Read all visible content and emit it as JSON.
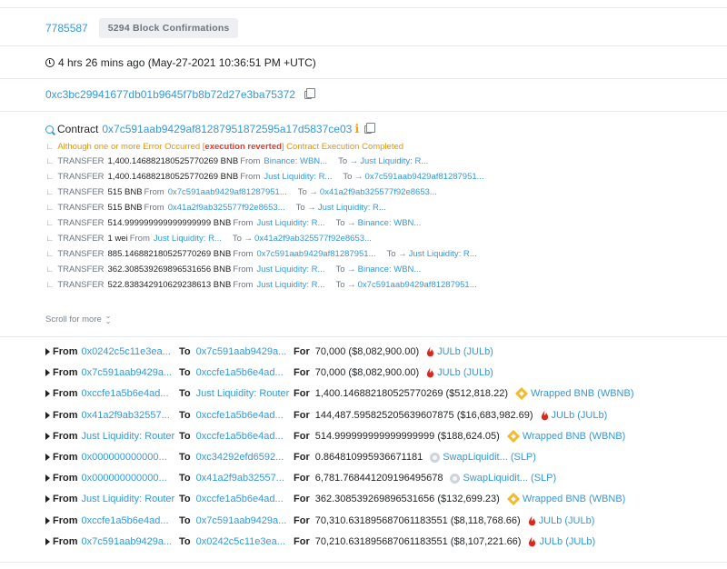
{
  "block": {
    "number": "7785587",
    "confirmations": "5294 Block Confirmations"
  },
  "timestamp": "4 hrs 26 mins ago (May-27-2021 10:36:51 PM +UTC)",
  "from_address": "0xc3bc29941677db01b9645f7b8b72d27e3ba75372",
  "interacted": {
    "label": "Contract",
    "address": "0x7c591aab9429af81287951872595a17d5837ce03",
    "status_pre": "Although one or more Error Occurred [",
    "status_error": "execution reverted",
    "status_post": "] Contract Execution Completed"
  },
  "internal_txs": [
    {
      "label": "TRANSFER",
      "amount": "1,400.146882180525770269 BNB",
      "from": "Binance: WBN...",
      "to": "Just Liquidity: R..."
    },
    {
      "label": "TRANSFER",
      "amount": "1,400.146882180525770269 BNB",
      "from": "Just Liquidity: R...",
      "to": "0x7c591aab9429af81287951..."
    },
    {
      "label": "TRANSFER",
      "amount": "515 BNB",
      "from": "0x7c591aab9429af81287951...",
      "to": "0x41a2f9ab325577f92e8653..."
    },
    {
      "label": "TRANSFER",
      "amount": "515 BNB",
      "from": "0x41a2f9ab325577f92e8653...",
      "to": "Just Liquidity: R..."
    },
    {
      "label": "TRANSFER",
      "amount": "514.999999999999999999 BNB",
      "from": "Just Liquidity: R...",
      "to": "Binance: WBN..."
    },
    {
      "label": "TRANSFER",
      "amount": "1 wei",
      "from": "Just Liquidity: R...",
      "to": "0x41a2f9ab325577f92e8653..."
    },
    {
      "label": "TRANSFER",
      "amount": "885.146882180525770269 BNB",
      "from": "0x7c591aab9429af81287951...",
      "to": "Just Liquidity: R..."
    },
    {
      "label": "TRANSFER",
      "amount": "362.308539269896531656 BNB",
      "from": "Just Liquidity: R...",
      "to": "Binance: WBN..."
    },
    {
      "label": "TRANSFER",
      "amount": "522.838342910629238613 BNB",
      "from": "Just Liquidity: R...",
      "to": "0x7c591aab9429af81287951..."
    }
  ],
  "tx_words": {
    "from": "From",
    "to": "To →",
    "tree": "∟"
  },
  "scroll_more": "Scroll for more",
  "token_words": {
    "from": "From",
    "to": "To",
    "for": "For"
  },
  "token_transfers": [
    {
      "from": "0x0242c5c11e3ea...",
      "to": "0x7c591aab9429a...",
      "amount": "70,000 ($8,082,900.00)",
      "token": "JULb (JULb)",
      "icon": "julb-icon"
    },
    {
      "from": "0x7c591aab9429a...",
      "to": "0xccfe1a5b6e4ad...",
      "amount": "70,000 ($8,082,900.00)",
      "token": "JULb (JULb)",
      "icon": "julb-icon"
    },
    {
      "from": "0xccfe1a5b6e4ad...",
      "to": "Just Liquidity: Router",
      "amount": "1,400.146882180525770269 ($512,818.22)",
      "token": "Wrapped BNB (WBNB)",
      "icon": "bnb-icon"
    },
    {
      "from": "0x41a2f9ab32557...",
      "to": "0xccfe1a5b6e4ad...",
      "amount": "144,487.595825205639607875 ($16,683,982.69)",
      "token": "JULb (JULb)",
      "icon": "julb-icon"
    },
    {
      "from": "Just Liquidity: Router",
      "to": "0xccfe1a5b6e4ad...",
      "amount": "514.999999999999999999 ($188,624.05)",
      "token": "Wrapped BNB (WBNB)",
      "icon": "bnb-icon"
    },
    {
      "from": "0x000000000000...",
      "to": "0xc34292efd6592...",
      "amount": "0.864810995936671181",
      "token": "SwapLiquidit... (SLP)",
      "icon": "slp-icon"
    },
    {
      "from": "0x000000000000...",
      "to": "0x41a2f9ab32557...",
      "amount": "6,781.768441209196495678",
      "token": "SwapLiquidit... (SLP)",
      "icon": "slp-icon"
    },
    {
      "from": "Just Liquidity: Router",
      "to": "0xccfe1a5b6e4ad...",
      "amount": "362.308539269896531656 ($132,699.23)",
      "token": "Wrapped BNB (WBNB)",
      "icon": "bnb-icon"
    },
    {
      "from": "0xccfe1a5b6e4ad...",
      "to": "0x7c591aab9429a...",
      "amount": "70,310.631895687061183551 ($8,118,768.66)",
      "token": "JULb (JULb)",
      "icon": "julb-icon"
    },
    {
      "from": "0x7c591aab9429a...",
      "to": "0x0242c5c11e3ea...",
      "amount": "70,210.631895687061183551 ($8,107,221.66)",
      "token": "JULb (JULb)",
      "icon": "julb-icon"
    }
  ],
  "colors": {
    "link": "#3498db",
    "warning": "#e59400",
    "error": "#e33a27",
    "julb": "#d9281d",
    "bnb": "#f3ba2f"
  }
}
